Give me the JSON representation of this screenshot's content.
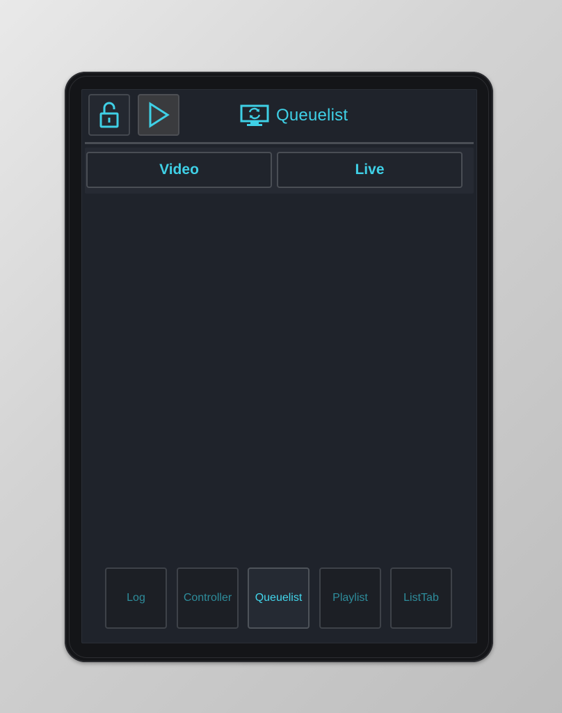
{
  "header": {
    "title": "Queuelist",
    "lock_icon": "unlocked-padlock-icon",
    "play_icon": "play-triangle-icon",
    "title_icon": "monitor-sync-icon"
  },
  "tabs": {
    "video_label": "Video",
    "live_label": "Live"
  },
  "bottom_nav": {
    "items": [
      {
        "label": "Log",
        "active": false
      },
      {
        "label": "Controller",
        "active": false
      },
      {
        "label": "Queuelist",
        "active": true
      },
      {
        "label": "Playlist",
        "active": false
      },
      {
        "label": "ListTab",
        "active": false
      }
    ]
  },
  "colors": {
    "accent": "#3fd0e6",
    "panel": "#1f232b",
    "frame": "#141518"
  }
}
